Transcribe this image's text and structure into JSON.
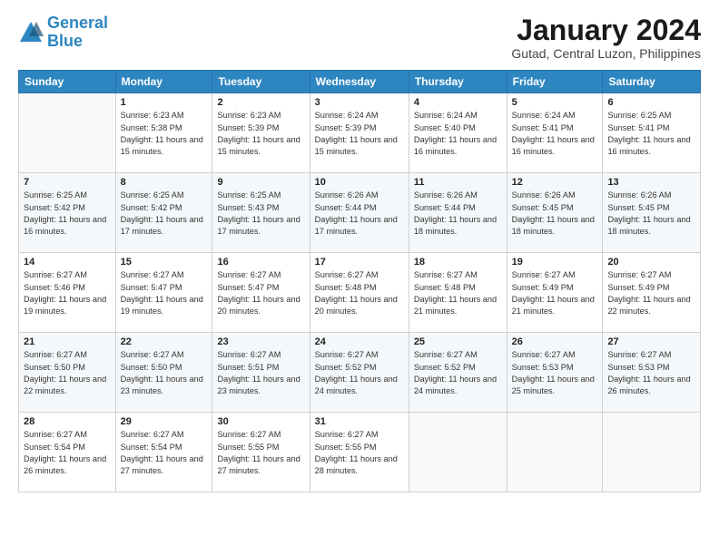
{
  "header": {
    "logo_line1": "General",
    "logo_line2": "Blue",
    "month": "January 2024",
    "location": "Gutad, Central Luzon, Philippines"
  },
  "days_of_week": [
    "Sunday",
    "Monday",
    "Tuesday",
    "Wednesday",
    "Thursday",
    "Friday",
    "Saturday"
  ],
  "weeks": [
    [
      {
        "day": "",
        "sunrise": "",
        "sunset": "",
        "daylight": ""
      },
      {
        "day": "1",
        "sunrise": "Sunrise: 6:23 AM",
        "sunset": "Sunset: 5:38 PM",
        "daylight": "Daylight: 11 hours and 15 minutes."
      },
      {
        "day": "2",
        "sunrise": "Sunrise: 6:23 AM",
        "sunset": "Sunset: 5:39 PM",
        "daylight": "Daylight: 11 hours and 15 minutes."
      },
      {
        "day": "3",
        "sunrise": "Sunrise: 6:24 AM",
        "sunset": "Sunset: 5:39 PM",
        "daylight": "Daylight: 11 hours and 15 minutes."
      },
      {
        "day": "4",
        "sunrise": "Sunrise: 6:24 AM",
        "sunset": "Sunset: 5:40 PM",
        "daylight": "Daylight: 11 hours and 16 minutes."
      },
      {
        "day": "5",
        "sunrise": "Sunrise: 6:24 AM",
        "sunset": "Sunset: 5:41 PM",
        "daylight": "Daylight: 11 hours and 16 minutes."
      },
      {
        "day": "6",
        "sunrise": "Sunrise: 6:25 AM",
        "sunset": "Sunset: 5:41 PM",
        "daylight": "Daylight: 11 hours and 16 minutes."
      }
    ],
    [
      {
        "day": "7",
        "sunrise": "Sunrise: 6:25 AM",
        "sunset": "Sunset: 5:42 PM",
        "daylight": "Daylight: 11 hours and 16 minutes."
      },
      {
        "day": "8",
        "sunrise": "Sunrise: 6:25 AM",
        "sunset": "Sunset: 5:42 PM",
        "daylight": "Daylight: 11 hours and 17 minutes."
      },
      {
        "day": "9",
        "sunrise": "Sunrise: 6:25 AM",
        "sunset": "Sunset: 5:43 PM",
        "daylight": "Daylight: 11 hours and 17 minutes."
      },
      {
        "day": "10",
        "sunrise": "Sunrise: 6:26 AM",
        "sunset": "Sunset: 5:44 PM",
        "daylight": "Daylight: 11 hours and 17 minutes."
      },
      {
        "day": "11",
        "sunrise": "Sunrise: 6:26 AM",
        "sunset": "Sunset: 5:44 PM",
        "daylight": "Daylight: 11 hours and 18 minutes."
      },
      {
        "day": "12",
        "sunrise": "Sunrise: 6:26 AM",
        "sunset": "Sunset: 5:45 PM",
        "daylight": "Daylight: 11 hours and 18 minutes."
      },
      {
        "day": "13",
        "sunrise": "Sunrise: 6:26 AM",
        "sunset": "Sunset: 5:45 PM",
        "daylight": "Daylight: 11 hours and 18 minutes."
      }
    ],
    [
      {
        "day": "14",
        "sunrise": "Sunrise: 6:27 AM",
        "sunset": "Sunset: 5:46 PM",
        "daylight": "Daylight: 11 hours and 19 minutes."
      },
      {
        "day": "15",
        "sunrise": "Sunrise: 6:27 AM",
        "sunset": "Sunset: 5:47 PM",
        "daylight": "Daylight: 11 hours and 19 minutes."
      },
      {
        "day": "16",
        "sunrise": "Sunrise: 6:27 AM",
        "sunset": "Sunset: 5:47 PM",
        "daylight": "Daylight: 11 hours and 20 minutes."
      },
      {
        "day": "17",
        "sunrise": "Sunrise: 6:27 AM",
        "sunset": "Sunset: 5:48 PM",
        "daylight": "Daylight: 11 hours and 20 minutes."
      },
      {
        "day": "18",
        "sunrise": "Sunrise: 6:27 AM",
        "sunset": "Sunset: 5:48 PM",
        "daylight": "Daylight: 11 hours and 21 minutes."
      },
      {
        "day": "19",
        "sunrise": "Sunrise: 6:27 AM",
        "sunset": "Sunset: 5:49 PM",
        "daylight": "Daylight: 11 hours and 21 minutes."
      },
      {
        "day": "20",
        "sunrise": "Sunrise: 6:27 AM",
        "sunset": "Sunset: 5:49 PM",
        "daylight": "Daylight: 11 hours and 22 minutes."
      }
    ],
    [
      {
        "day": "21",
        "sunrise": "Sunrise: 6:27 AM",
        "sunset": "Sunset: 5:50 PM",
        "daylight": "Daylight: 11 hours and 22 minutes."
      },
      {
        "day": "22",
        "sunrise": "Sunrise: 6:27 AM",
        "sunset": "Sunset: 5:50 PM",
        "daylight": "Daylight: 11 hours and 23 minutes."
      },
      {
        "day": "23",
        "sunrise": "Sunrise: 6:27 AM",
        "sunset": "Sunset: 5:51 PM",
        "daylight": "Daylight: 11 hours and 23 minutes."
      },
      {
        "day": "24",
        "sunrise": "Sunrise: 6:27 AM",
        "sunset": "Sunset: 5:52 PM",
        "daylight": "Daylight: 11 hours and 24 minutes."
      },
      {
        "day": "25",
        "sunrise": "Sunrise: 6:27 AM",
        "sunset": "Sunset: 5:52 PM",
        "daylight": "Daylight: 11 hours and 24 minutes."
      },
      {
        "day": "26",
        "sunrise": "Sunrise: 6:27 AM",
        "sunset": "Sunset: 5:53 PM",
        "daylight": "Daylight: 11 hours and 25 minutes."
      },
      {
        "day": "27",
        "sunrise": "Sunrise: 6:27 AM",
        "sunset": "Sunset: 5:53 PM",
        "daylight": "Daylight: 11 hours and 26 minutes."
      }
    ],
    [
      {
        "day": "28",
        "sunrise": "Sunrise: 6:27 AM",
        "sunset": "Sunset: 5:54 PM",
        "daylight": "Daylight: 11 hours and 26 minutes."
      },
      {
        "day": "29",
        "sunrise": "Sunrise: 6:27 AM",
        "sunset": "Sunset: 5:54 PM",
        "daylight": "Daylight: 11 hours and 27 minutes."
      },
      {
        "day": "30",
        "sunrise": "Sunrise: 6:27 AM",
        "sunset": "Sunset: 5:55 PM",
        "daylight": "Daylight: 11 hours and 27 minutes."
      },
      {
        "day": "31",
        "sunrise": "Sunrise: 6:27 AM",
        "sunset": "Sunset: 5:55 PM",
        "daylight": "Daylight: 11 hours and 28 minutes."
      },
      {
        "day": "",
        "sunrise": "",
        "sunset": "",
        "daylight": ""
      },
      {
        "day": "",
        "sunrise": "",
        "sunset": "",
        "daylight": ""
      },
      {
        "day": "",
        "sunrise": "",
        "sunset": "",
        "daylight": ""
      }
    ]
  ]
}
